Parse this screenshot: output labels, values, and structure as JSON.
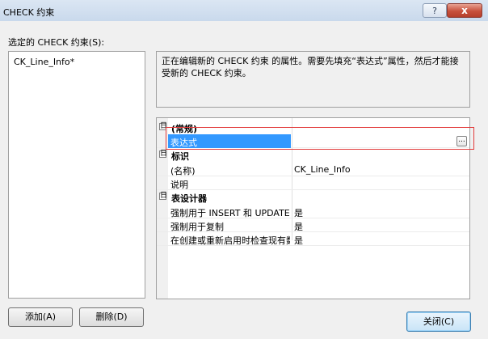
{
  "window": {
    "title": "CHECK 约束",
    "help_symbol": "?",
    "close_symbol": "x"
  },
  "left": {
    "label": "选定的 CHECK 约束(S):",
    "items": [
      "CK_Line_Info*"
    ]
  },
  "description": "正在编辑新的 CHECK 约束 的属性。需要先填充“表达式”属性，然后才能接受新的 CHECK 约束。",
  "grid": {
    "categories": {
      "general": "(常规)",
      "identity": "标识",
      "designer": "表设计器"
    },
    "toggle_symbol": "日",
    "properties": {
      "expression": {
        "name": "表达式",
        "value": ""
      },
      "name": {
        "name": "(名称)",
        "value": "CK_Line_Info"
      },
      "description": {
        "name": "说明",
        "value": ""
      },
      "enforce_insert_update": {
        "name": "强制用于 INSERT 和 UPDATE",
        "value": "是"
      },
      "enforce_replication": {
        "name": "强制用于复制",
        "value": "是"
      },
      "check_existing": {
        "name": "在创建或重新启用时检查现有数据",
        "value": "是"
      }
    },
    "ellipsis": "..."
  },
  "buttons": {
    "add": "添加(A)",
    "delete": "删除(D)",
    "close": "关闭(C)"
  },
  "colors": {
    "selection": "#3399ff",
    "highlight_frame": "#e23c3c"
  }
}
